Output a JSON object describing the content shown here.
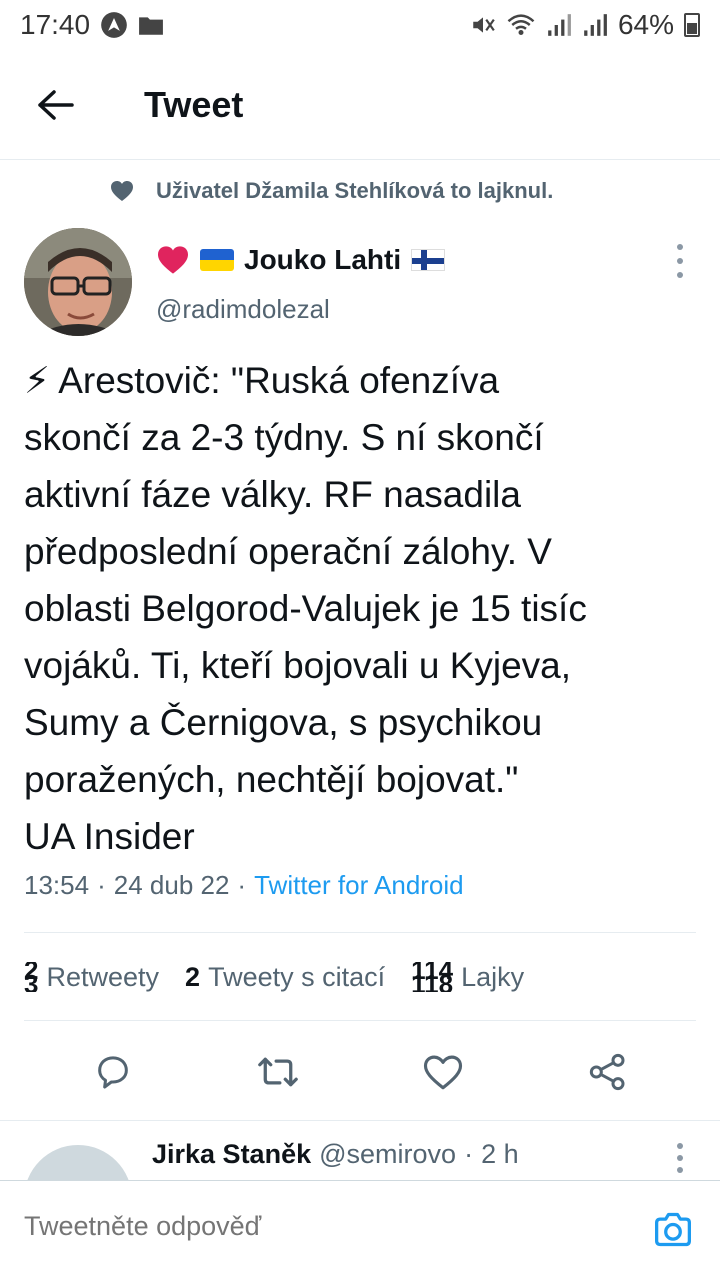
{
  "status_bar": {
    "time": "17:40",
    "battery": "64%"
  },
  "app_bar": {
    "title": "Tweet"
  },
  "social_context": {
    "text": "Uživatel Džamila Stehlíková to lajknul."
  },
  "tweet": {
    "author_name": "Jouko Lahti",
    "handle": "@radimdolezal",
    "text_lines": [
      "⚡ Arestovič: \"Ruská ofenzíva",
      "skončí za 2-3 týdny. S ní skončí",
      "aktivní fáze války. RF nasadila",
      "předposlední operační zálohy. V",
      "oblasti Belgorod-Valujek je 15 tisíc",
      "vojáků. Ti, kteří  bojovali u Kyjeva,",
      "Sumy a Černigova, s psychikou",
      "poražených, nechtějí bojovat.\"",
      "UA Insider"
    ],
    "time": "13:54",
    "date": "24 dub 22",
    "source": "Twitter for Android",
    "separator": "·"
  },
  "stats": {
    "retweets_old": "2",
    "retweets_new": "3",
    "retweets_label": "Retweety",
    "quotes": "2",
    "quotes_label": "Tweety s citací",
    "likes_old": "114",
    "likes_new": "118",
    "likes_label": "Lajky"
  },
  "reply_preview": {
    "name": "Jirka Staněk",
    "handle": "@semirovo",
    "separator": "·",
    "age": "2 h"
  },
  "composer": {
    "placeholder": "Tweetněte odpověď"
  },
  "colors": {
    "accent": "#1d9bf0",
    "secondary_text": "#536471",
    "heart": "#e0245e"
  },
  "icons": [
    "back-arrow-icon",
    "heart-icon",
    "more-icon",
    "reply-icon",
    "retweet-icon",
    "like-icon",
    "share-icon",
    "camera-icon"
  ]
}
